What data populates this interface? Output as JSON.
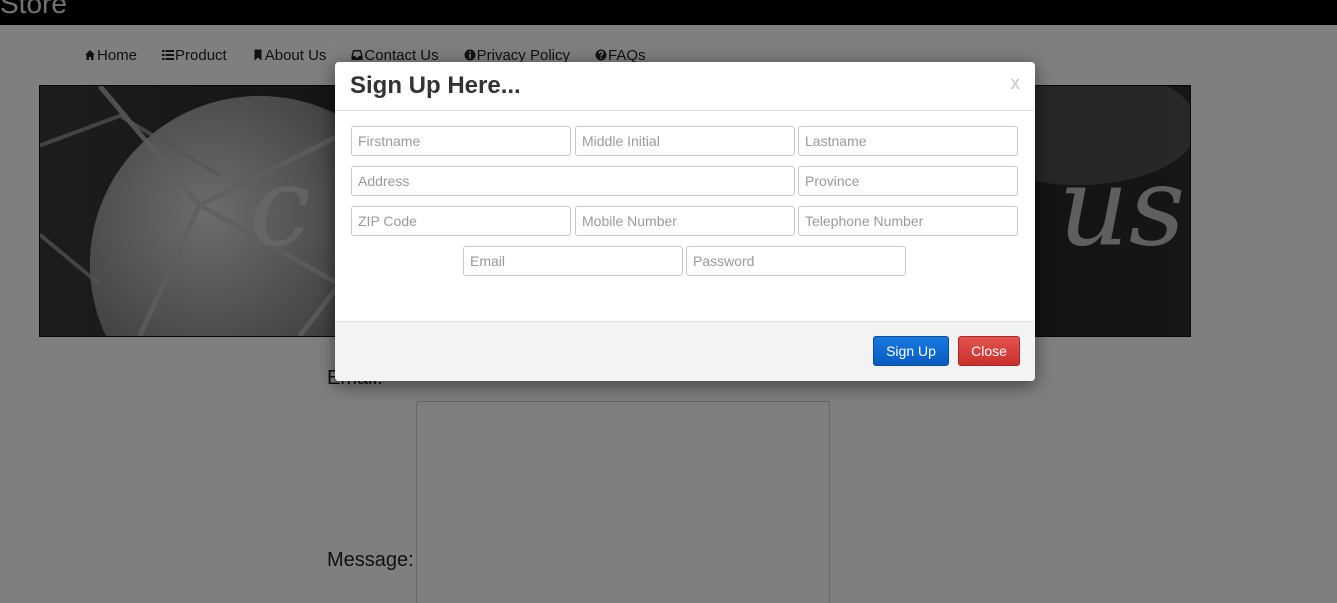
{
  "site": {
    "brand": "Store"
  },
  "nav": {
    "items": [
      {
        "label": "Home",
        "icon": "home-icon"
      },
      {
        "label": "Product",
        "icon": "list-icon"
      },
      {
        "label": "About Us",
        "icon": "bookmark-icon"
      },
      {
        "label": "Contact Us",
        "icon": "inbox-icon"
      },
      {
        "label": "Privacy Policy",
        "icon": "info-icon"
      },
      {
        "label": "FAQs",
        "icon": "question-icon"
      }
    ]
  },
  "contact_form": {
    "email_label": "Email:",
    "message_label": "Message:"
  },
  "modal": {
    "title": "Sign Up Here...",
    "close_x": "x",
    "fields": {
      "firstname": "Firstname",
      "middle_initial": "Middle Initial",
      "lastname": "Lastname",
      "address": "Address",
      "province": "Province",
      "zip": "ZIP Code",
      "mobile": "Mobile Number",
      "telephone": "Telephone Number",
      "email": "Email",
      "password": "Password"
    },
    "buttons": {
      "signup": "Sign Up",
      "close": "Close"
    }
  },
  "colors": {
    "primary": "#0a5cbf",
    "danger": "#c9302c",
    "topbar": "#000000"
  }
}
